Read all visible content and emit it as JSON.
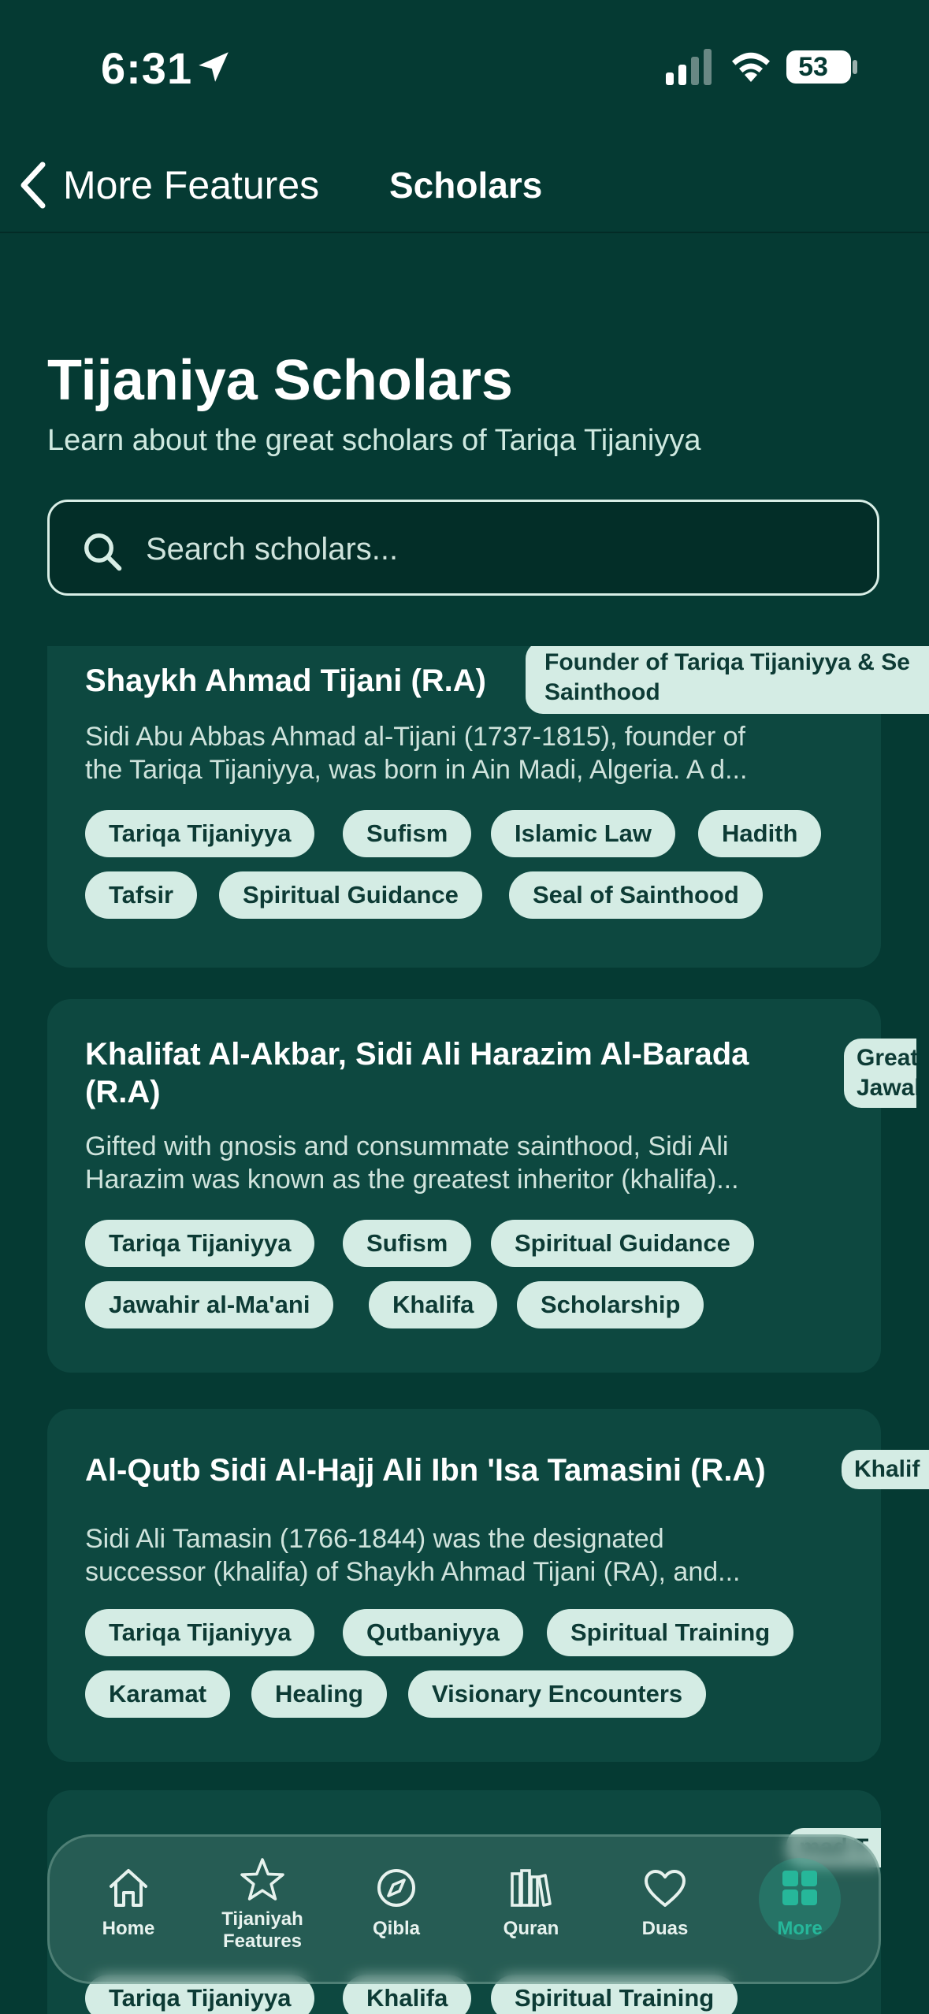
{
  "status_bar": {
    "time": "6:31",
    "battery": "53"
  },
  "nav": {
    "back_label": "More Features",
    "title": "Scholars"
  },
  "header": {
    "title": "Tijaniya Scholars",
    "subtitle": "Learn about the great scholars of Tariqa Tijaniyya"
  },
  "search": {
    "placeholder": "Search scholars..."
  },
  "scholars": [
    {
      "name": "Shaykh Ahmad Tijani (R.A)",
      "badge": "Founder of Tariqa Tijaniyya & Seal of Sainthood",
      "badge_line1": "Founder of Tariqa Tijaniyya & Se",
      "badge_line2": "Sainthood",
      "desc_line1": "Sidi Abu Abbas Ahmad al-Tijani (1737-1815), founder of",
      "desc_line2": "the Tariqa Tijaniyya, was born in Ain Madi, Algeria. A d...",
      "tags": [
        "Tariqa Tijaniyya",
        "Sufism",
        "Islamic Law",
        "Hadith",
        "Tafsir",
        "Spiritual Guidance",
        "Seal of Sainthood"
      ]
    },
    {
      "name_line1": "Khalifat Al-Akbar, Sidi Ali Harazim Al-Barada",
      "name_line2": "(R.A)",
      "badge_line1": "Great",
      "badge_line2": "Jawal",
      "desc_line1": "Gifted with gnosis and consummate sainthood, Sidi Ali",
      "desc_line2": "Harazim was known as the greatest inheritor (khalifa)...",
      "tags": [
        "Tariqa Tijaniyya",
        "Sufism",
        "Spiritual Guidance",
        "Jawahir al-Ma'ani",
        "Khalifa",
        "Scholarship"
      ]
    },
    {
      "name": "Al-Qutb Sidi Al-Hajj Ali Ibn 'Isa Tamasini (R.A)",
      "badge": "Khalif",
      "desc_line1": "Sidi Ali Tamasin (1766-1844) was the designated",
      "desc_line2": "successor (khalifa) of Shaykh Ahmad Tijani (RA), and...",
      "tags": [
        "Tariqa Tijaniyya",
        "Qutbaniyya",
        "Spiritual Training",
        "Karamat",
        "Healing",
        "Visionary Encounters"
      ]
    },
    {
      "badge": "mad T",
      "tags": [
        "Tariqa Tijaniyya",
        "Khalifa",
        "Spiritual Training"
      ]
    }
  ],
  "tabs": [
    {
      "label": "Home",
      "icon": "home-icon"
    },
    {
      "label_line1": "Tijaniyah",
      "label_line2": "Features",
      "icon": "star-icon"
    },
    {
      "label": "Qibla",
      "icon": "compass-icon"
    },
    {
      "label": "Quran",
      "icon": "books-icon"
    },
    {
      "label": "Duas",
      "icon": "heart-icon"
    },
    {
      "label": "More",
      "icon": "grid-icon",
      "active": true
    }
  ],
  "colors": {
    "background": "#053a33",
    "card": "#0d4840",
    "tag": "#d4ece4",
    "accent": "#26b79a"
  }
}
